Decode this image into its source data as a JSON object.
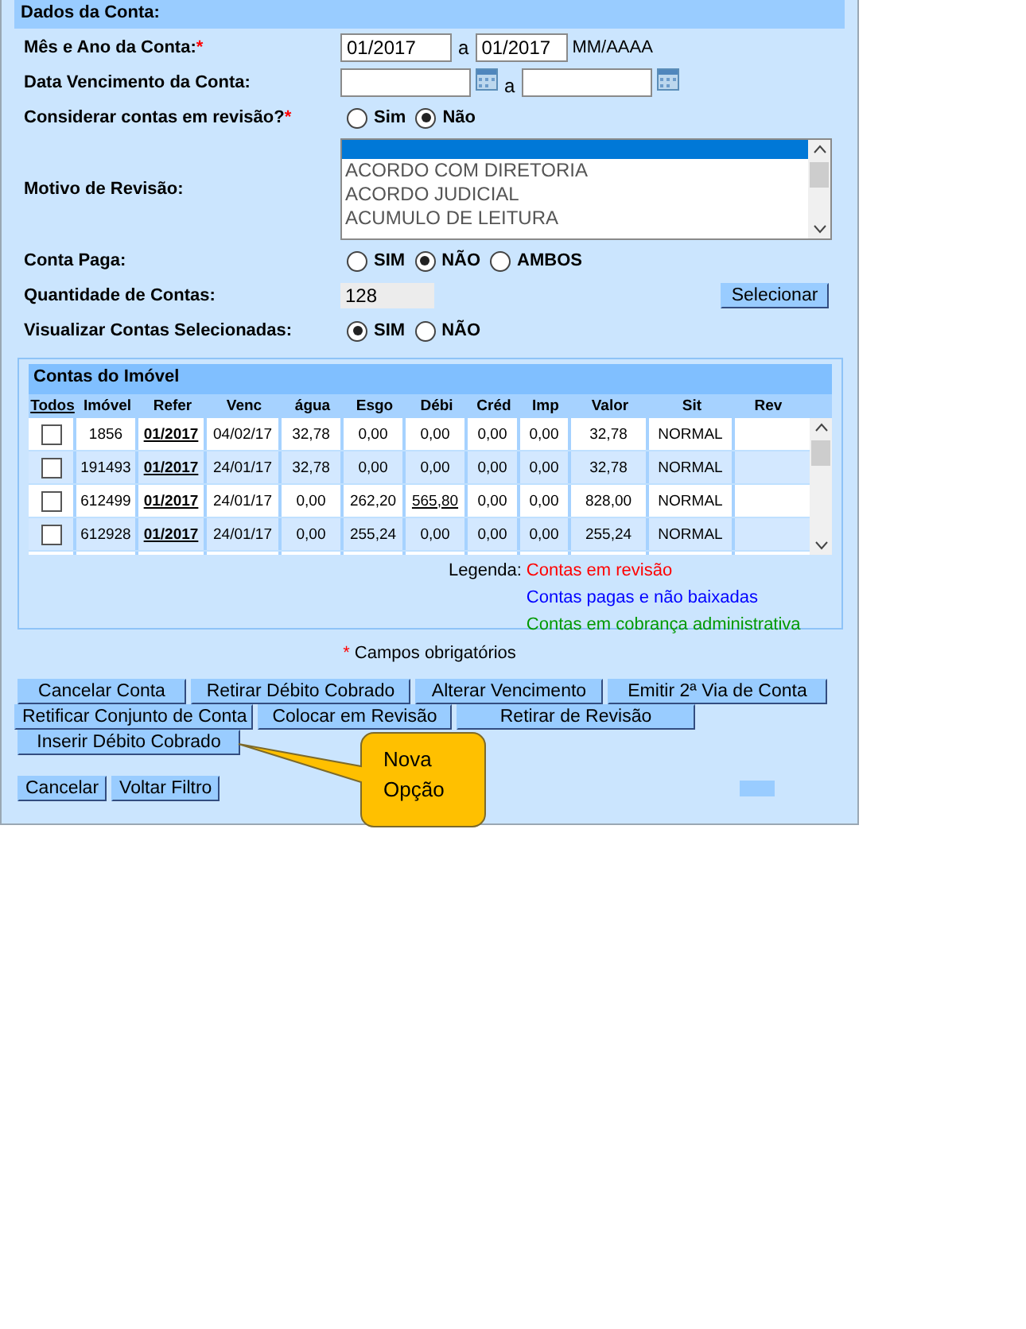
{
  "section_title": "Dados da Conta:",
  "month_year": {
    "label": "Mês e Ano da Conta:",
    "required_mark": "*",
    "from": "01/2017",
    "separator": "a",
    "to": "01/2017",
    "hint": "MM/AAAA"
  },
  "due_date": {
    "label": "Data Vencimento da Conta:",
    "separator": "a"
  },
  "consider_revision": {
    "label": "Considerar contas em revisão?",
    "required_mark": "*",
    "options": [
      {
        "label": "Sim",
        "selected": false
      },
      {
        "label": "Não",
        "selected": true
      }
    ]
  },
  "revision_reason": {
    "label": "Motivo de Revisão:",
    "blank_option_selected": true,
    "options": [
      {
        "label": "ACORDO COM DIRETORIA",
        "selected": false
      },
      {
        "label": "ACORDO JUDICIAL",
        "selected": false
      },
      {
        "label": "ACUMULO DE LEITURA",
        "selected": false
      }
    ]
  },
  "paid": {
    "label": "Conta Paga:",
    "options": [
      {
        "label": "SIM",
        "selected": false
      },
      {
        "label": "NÃO",
        "selected": true
      },
      {
        "label": "AMBOS",
        "selected": false
      }
    ]
  },
  "quantity": {
    "label": "Quantidade de Contas:",
    "value": "128",
    "button": "Selecionar"
  },
  "show_selected": {
    "label": "Visualizar Contas Selecionadas:",
    "options": [
      {
        "label": "SIM",
        "selected": true
      },
      {
        "label": "NÃO",
        "selected": false
      }
    ]
  },
  "table": {
    "title": "Contas do Imóvel",
    "select_all": "Todos",
    "columns": [
      "Imóvel",
      "Refer",
      "Venc",
      "água",
      "Esgo",
      "Débi",
      "Créd",
      "Imp",
      "Valor",
      "Sit",
      "Rev"
    ],
    "rows": [
      {
        "checked": false,
        "debit_link": false,
        "cells": [
          "1856",
          "01/2017",
          "04/02/17",
          "32,78",
          "0,00",
          "0,00",
          "0,00",
          "0,00",
          "32,78",
          "NORMAL"
        ]
      },
      {
        "checked": false,
        "debit_link": false,
        "cells": [
          "191493",
          "01/2017",
          "24/01/17",
          "32,78",
          "0,00",
          "0,00",
          "0,00",
          "0,00",
          "32,78",
          "NORMAL"
        ]
      },
      {
        "checked": false,
        "debit_link": true,
        "cells": [
          "612499",
          "01/2017",
          "24/01/17",
          "0,00",
          "262,20",
          "565,80",
          "0,00",
          "0,00",
          "828,00",
          "NORMAL"
        ]
      },
      {
        "checked": false,
        "debit_link": false,
        "cells": [
          "612928",
          "01/2017",
          "24/01/17",
          "0,00",
          "255,24",
          "0,00",
          "0,00",
          "0,00",
          "255,24",
          "NORMAL"
        ]
      }
    ]
  },
  "legend": {
    "label": "Legenda:",
    "items": [
      {
        "label": "Contas em revisão",
        "color": "#ff0000"
      },
      {
        "label": "Contas pagas e não baixadas",
        "color": "#0000ff"
      },
      {
        "label": "Contas em cobrança administrativa",
        "color": "#009900"
      }
    ]
  },
  "required_note": {
    "mark": "*",
    "text": "Campos obrigatórios"
  },
  "action_rows": [
    [
      "Cancelar Conta",
      "Retirar Débito Cobrado",
      "Alterar Vencimento",
      "Emitir 2ª Via de Conta"
    ],
    [
      "Retificar Conjunto de Conta",
      "Colocar em Revisão",
      "Retirar de Revisão"
    ],
    [
      "Inserir Débito Cobrado"
    ]
  ],
  "callout": "Nova Opção",
  "bottom_buttons": [
    "Cancelar",
    "Voltar Filtro"
  ]
}
